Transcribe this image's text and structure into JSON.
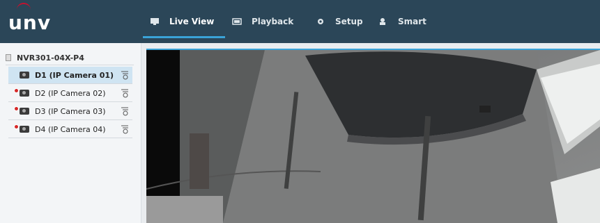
{
  "app": {
    "logo_text": "unv"
  },
  "nav": {
    "items": [
      {
        "label": "Live View",
        "icon": "monitor-icon",
        "active": true
      },
      {
        "label": "Playback",
        "icon": "film-icon",
        "active": false
      },
      {
        "label": "Setup",
        "icon": "gear-icon",
        "active": false
      },
      {
        "label": "Smart",
        "icon": "user-smart-icon",
        "active": false
      }
    ]
  },
  "sidebar": {
    "device_name": "NVR301-04X-P4",
    "cameras": [
      {
        "label": "D1 (IP Camera 01)",
        "selected": true,
        "offline": false
      },
      {
        "label": "D2 (IP Camera 02)",
        "selected": false,
        "offline": true
      },
      {
        "label": "D3 (IP Camera 03)",
        "selected": false,
        "offline": true
      },
      {
        "label": "D4 (IP Camera 04)",
        "selected": false,
        "offline": true
      }
    ]
  },
  "colors": {
    "topbar": "#2b4658",
    "accent": "#3aa3d8",
    "brand_red": "#c8102e",
    "selected_row": "#cfe4f2"
  }
}
